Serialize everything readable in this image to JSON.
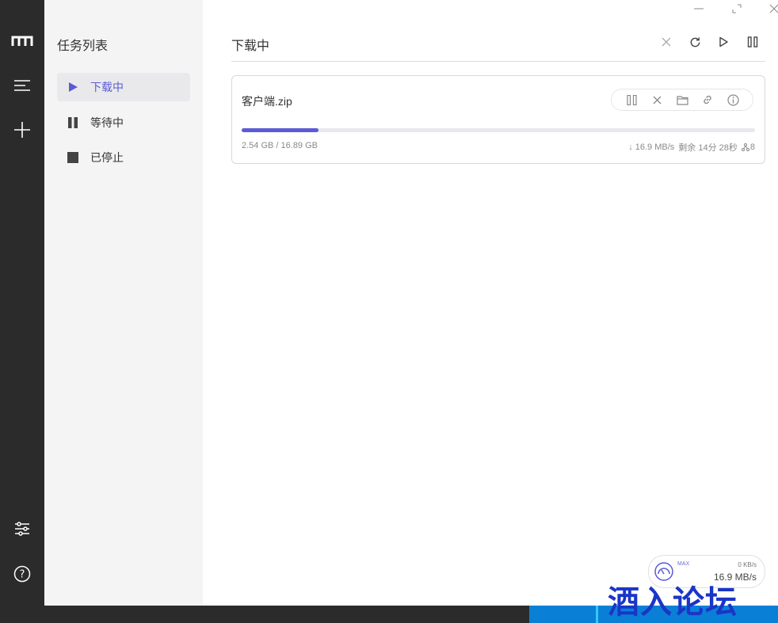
{
  "rail": {
    "icons": [
      "app-logo-icon",
      "menu-icon",
      "add-icon",
      "preferences-icon",
      "help-icon"
    ]
  },
  "sidebar": {
    "title": "任务列表",
    "items": [
      {
        "label": "下载中",
        "icon": "play-icon",
        "active": true
      },
      {
        "label": "等待中",
        "icon": "pause-icon",
        "active": false
      },
      {
        "label": "已停止",
        "icon": "stop-icon",
        "active": false
      }
    ]
  },
  "header": {
    "title": "下载中",
    "actions": [
      "close-icon",
      "refresh-icon",
      "resume-all-icon",
      "pause-all-icon"
    ]
  },
  "task": {
    "name": "客户端.zip",
    "progress_text": "2.54 GB / 16.89 GB",
    "progress_fraction": 0.15,
    "speed": "↓ 16.9 MB/s",
    "remaining": "剩余 14分 28秒",
    "connections": "8",
    "actions": [
      "pause-icon",
      "delete-icon",
      "folder-icon",
      "link-icon",
      "info-icon"
    ]
  },
  "speedometer": {
    "max_label": "MAX",
    "upload": "0 KB/s",
    "download": "16.9 MB/s"
  },
  "watermark": "酒入论坛",
  "colors": {
    "accent": "#5b5bd6",
    "rail_bg": "#2b2b2b",
    "sidebar_bg": "#f4f4f5",
    "taskbar_blue": "#0a7fd6",
    "watermark": "#1a35c7"
  }
}
